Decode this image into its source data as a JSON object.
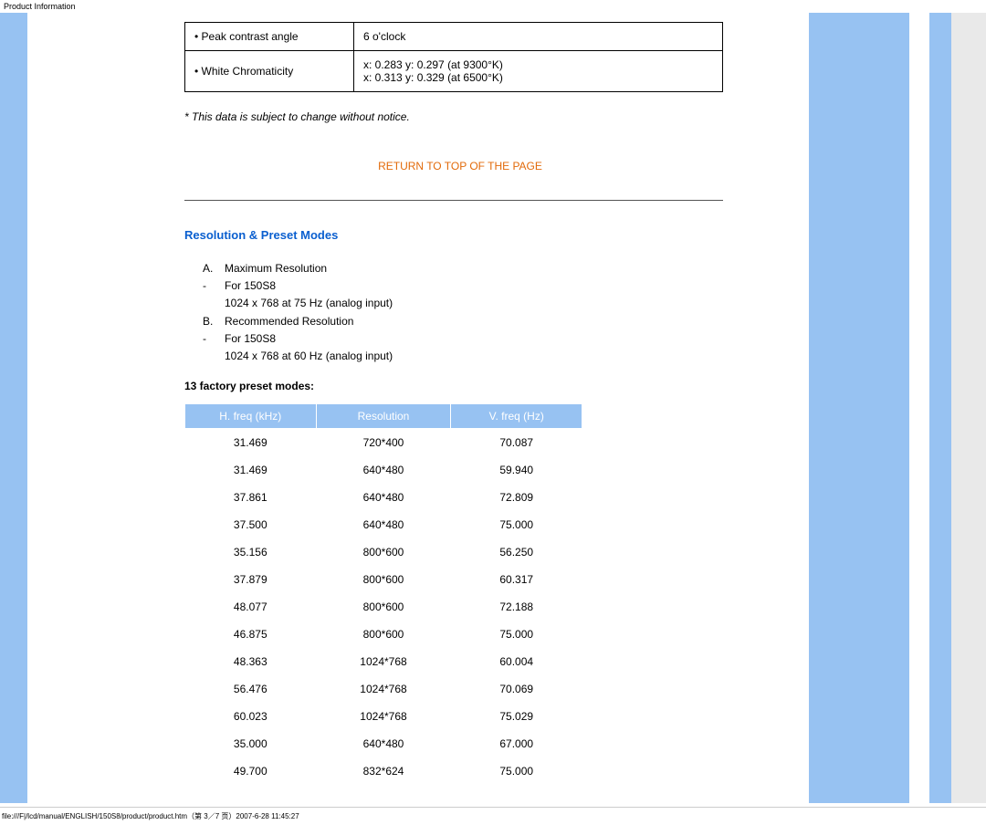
{
  "page_header": "Product Information",
  "spec_table": {
    "rows": [
      {
        "label": "• Peak contrast angle",
        "value": "6 o'clock"
      },
      {
        "label": "• White Chromaticity",
        "value": "x: 0.283 y: 0.297 (at 9300°K)\nx: 0.313 y: 0.329 (at 6500°K)"
      }
    ]
  },
  "footnote": "* This data is subject to change without notice.",
  "return_link": "RETURN TO TOP OF THE PAGE",
  "section_heading": "Resolution & Preset Modes",
  "resolution_list": [
    {
      "mark": "A.",
      "text": "Maximum Resolution"
    },
    {
      "mark": "-",
      "text": "For 150S8"
    },
    {
      "mark": "",
      "text": "1024 x 768 at 75 Hz (analog input)"
    },
    {
      "mark": "B.",
      "text": "Recommended Resolution"
    },
    {
      "mark": "-",
      "text": "For 150S8"
    },
    {
      "mark": "",
      "text": "1024 x 768 at 60 Hz (analog input)"
    }
  ],
  "preset_label": "13 factory preset modes:",
  "preset_headers": [
    "H. freq (kHz)",
    "Resolution",
    "V. freq (Hz)"
  ],
  "chart_data": {
    "type": "table",
    "columns": [
      "H. freq (kHz)",
      "Resolution",
      "V. freq (Hz)"
    ],
    "rows": [
      [
        "31.469",
        "720*400",
        "70.087"
      ],
      [
        "31.469",
        "640*480",
        "59.940"
      ],
      [
        "37.861",
        "640*480",
        "72.809"
      ],
      [
        "37.500",
        "640*480",
        "75.000"
      ],
      [
        "35.156",
        "800*600",
        "56.250"
      ],
      [
        "37.879",
        "800*600",
        "60.317"
      ],
      [
        "48.077",
        "800*600",
        "72.188"
      ],
      [
        "46.875",
        "800*600",
        "75.000"
      ],
      [
        "48.363",
        "1024*768",
        "60.004"
      ],
      [
        "56.476",
        "1024*768",
        "70.069"
      ],
      [
        "60.023",
        "1024*768",
        "75.029"
      ],
      [
        "35.000",
        "640*480",
        "67.000"
      ],
      [
        "49.700",
        "832*624",
        "75.000"
      ]
    ]
  },
  "footer_path": "file:///F|/lcd/manual/ENGLISH/150S8/product/product.htm（第 3／7 页）2007-6-28 11:45:27"
}
